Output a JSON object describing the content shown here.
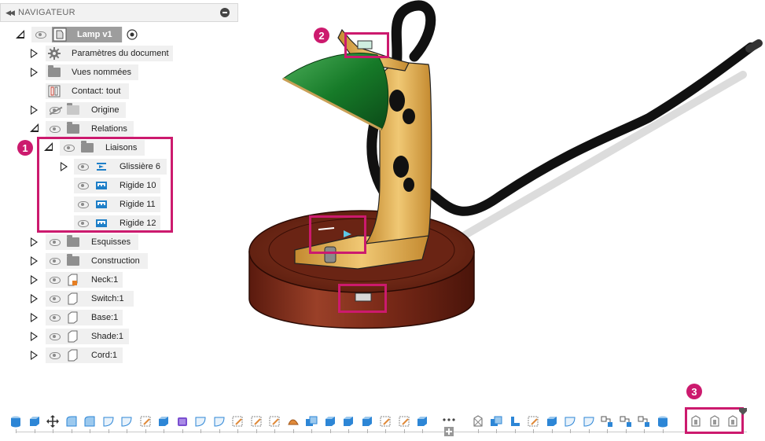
{
  "navigator": {
    "title": "NAVIGATEUR",
    "collapse_icon": "double-chevron-left-icon",
    "minimize_icon": "minus-circle-icon",
    "root": {
      "label": "Lamp v1"
    },
    "items": [
      {
        "label": "Paramètres du document",
        "icon": "gear-icon"
      },
      {
        "label": "Vues nommées",
        "icon": "folder-icon"
      },
      {
        "label": "Contact: tout",
        "icon": "contact-icon"
      },
      {
        "label": "Origine",
        "icon": "folder-icon"
      },
      {
        "label": "Relations",
        "icon": "folder-icon"
      },
      {
        "label": "Liaisons",
        "icon": "folder-icon"
      },
      {
        "label": "Glissière 6",
        "icon": "slider-joint-icon"
      },
      {
        "label": "Rigide 10",
        "icon": "rigid-joint-icon"
      },
      {
        "label": "Rigide 11",
        "icon": "rigid-joint-icon"
      },
      {
        "label": "Rigide 12",
        "icon": "rigid-joint-icon"
      },
      {
        "label": "Esquisses",
        "icon": "folder-icon"
      },
      {
        "label": "Construction",
        "icon": "folder-icon"
      },
      {
        "label": "Neck:1",
        "icon": "component-icon"
      },
      {
        "label": "Switch:1",
        "icon": "component-icon"
      },
      {
        "label": "Base:1",
        "icon": "component-icon"
      },
      {
        "label": "Shade:1",
        "icon": "component-icon"
      },
      {
        "label": "Cord:1",
        "icon": "component-icon"
      }
    ]
  },
  "callouts": [
    "1",
    "2",
    "3"
  ],
  "colors": {
    "callout": "#cc1a6e",
    "shade_green": "#1e7a2e",
    "brass": "#d9a94a",
    "wood": "#7a2a18",
    "cord": "#1a1a1a"
  },
  "timeline": {
    "icons": [
      "cylinder-icon",
      "box-icon",
      "move-icon",
      "fillet-icon",
      "chamfer-icon",
      "shell-icon",
      "sketch-icon",
      "extrude-icon",
      "combine-icon",
      "revolve-icon",
      "sweep-icon",
      "joint-icon",
      "rigid-group-icon",
      "pattern-icon",
      "pin-icon",
      "section-icon",
      "assembly-icon",
      "joint-origin-icon",
      "rigid-joint-icon",
      "slider-joint-icon"
    ]
  }
}
